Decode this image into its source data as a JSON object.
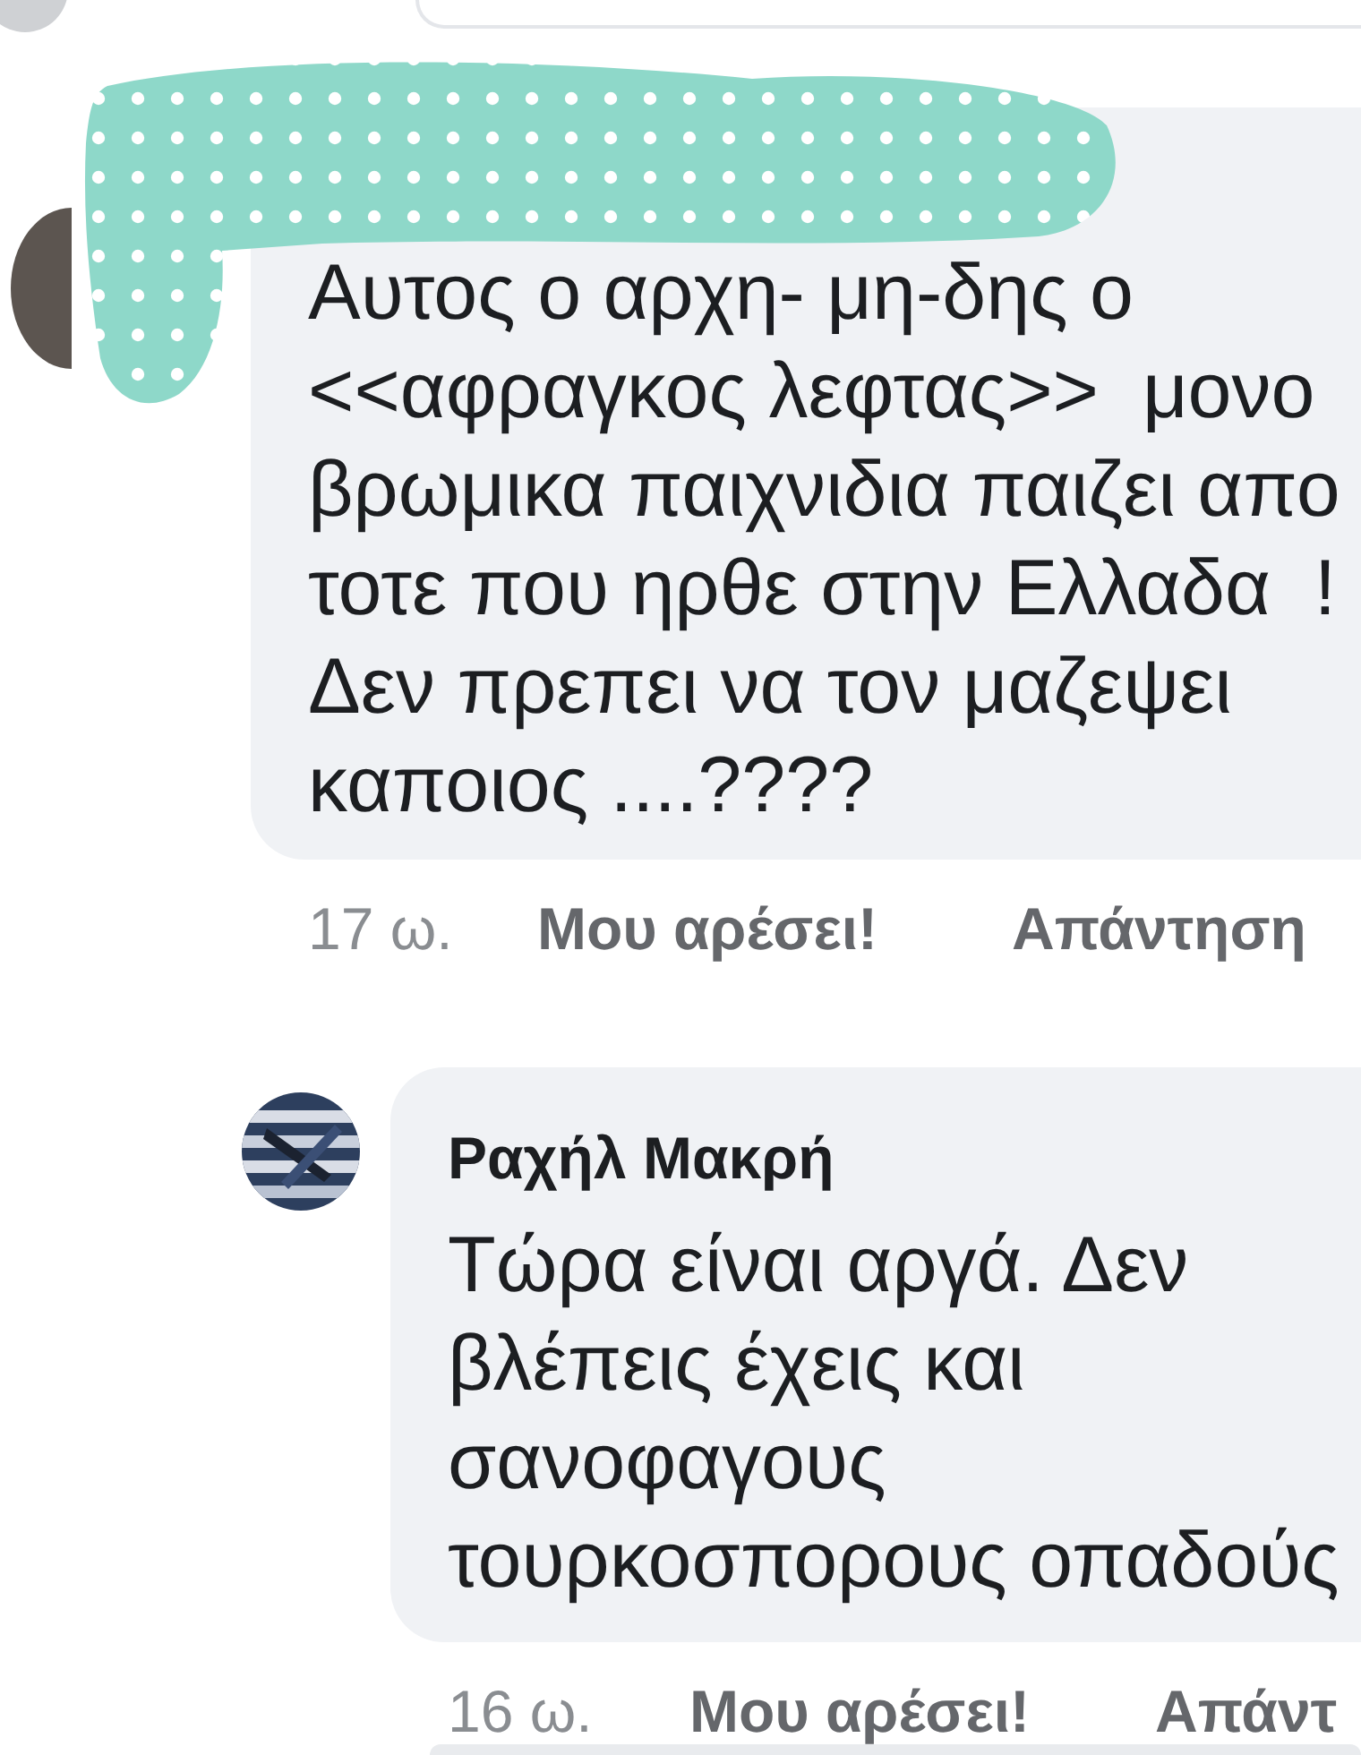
{
  "comments": [
    {
      "text_lines": [
        "Αυτος ο αρχη- μη-δης ο",
        "<<αφραγκος λεφτας>>  μονο",
        "βρωμικα παιχνιδια παιζει απο",
        "τοτε που ηρθε στην Ελλαδα  !",
        "Δεν πρεπει να τον μαζεψει",
        "καποιος ....????"
      ],
      "time": "17 ω.",
      "like": "Μου αρέσει!",
      "reply": "Απάντηση",
      "replies": [
        {
          "author": "Ραχήλ Μακρή",
          "text_lines": [
            "Τώρα είναι αργά. Δεν",
            "βλέπεις έχεις και",
            "σανοφαγους",
            "τουρκοσπορους οπαδούς"
          ],
          "time": "16 ω.",
          "like": "Μου αρέσει!",
          "reply": "Απάντ"
        }
      ]
    }
  ]
}
